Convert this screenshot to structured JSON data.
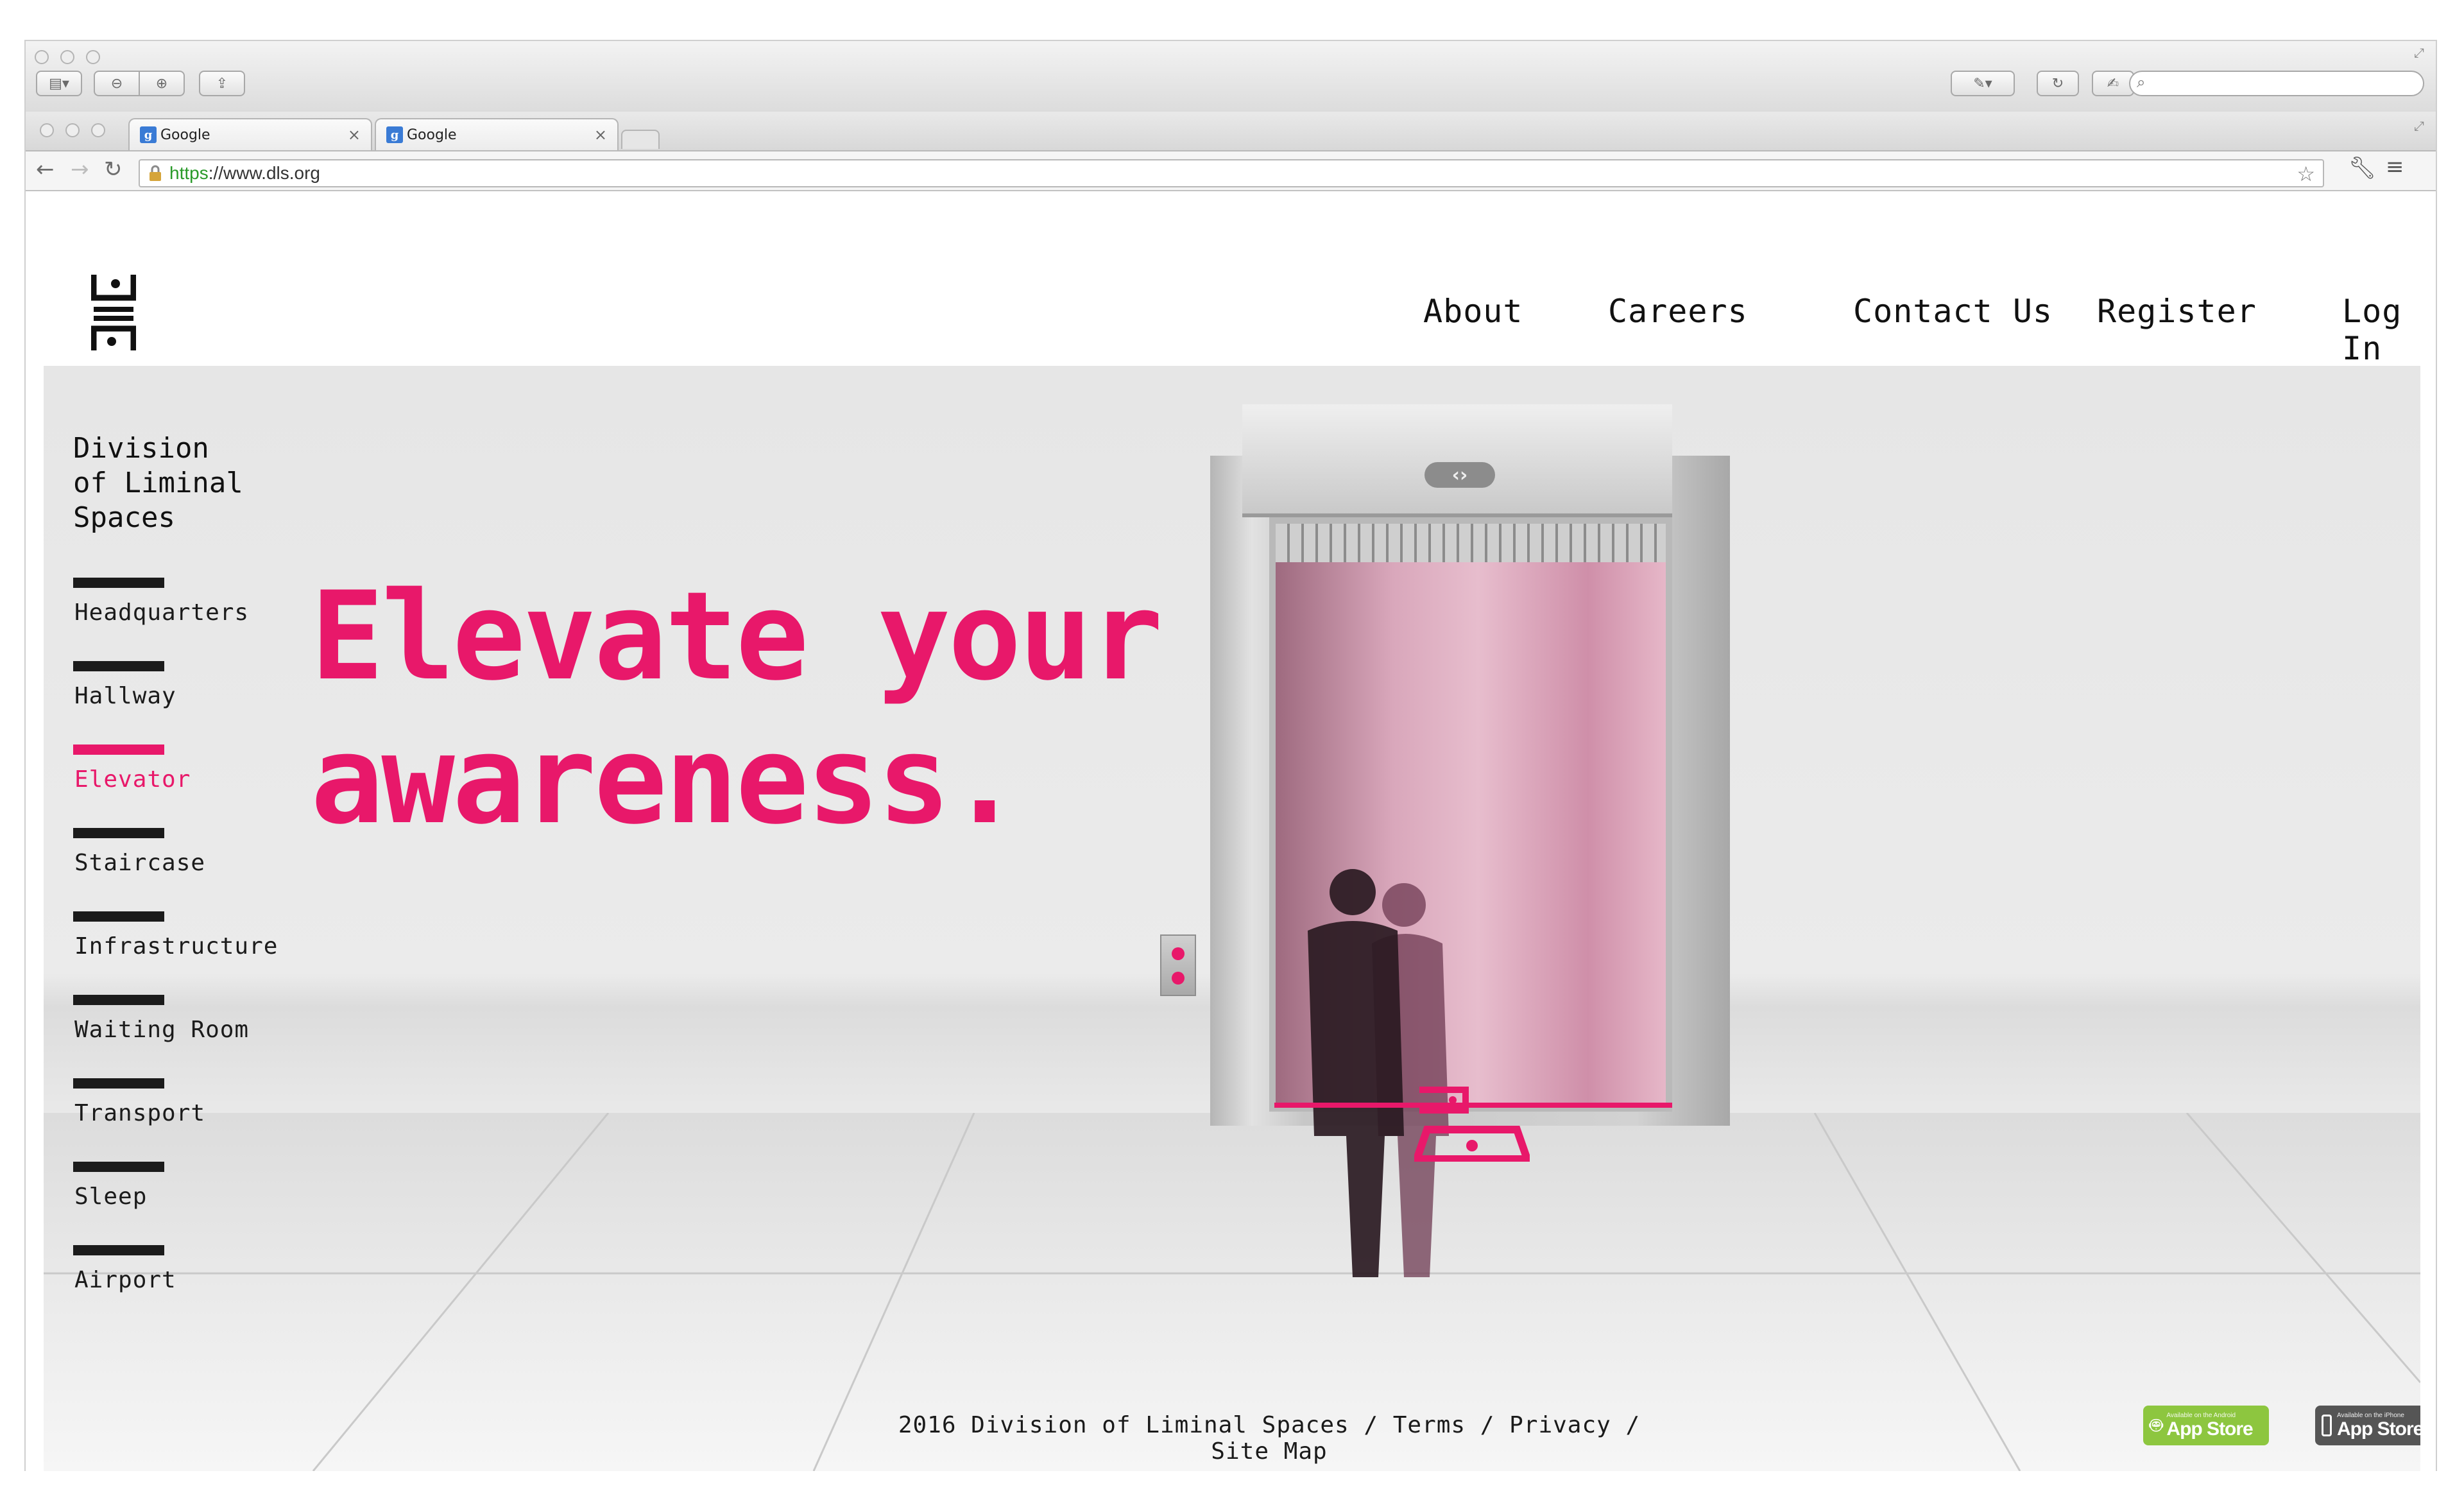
{
  "browser": {
    "tabs": [
      {
        "label": "Google",
        "favicon": "g"
      },
      {
        "label": "Google",
        "favicon": "g"
      }
    ],
    "url": {
      "scheme": "https",
      "rest": "://www.dls.org"
    }
  },
  "site": {
    "nav": [
      "About",
      "Careers",
      "Contact Us",
      "Register",
      "Log In"
    ],
    "brand": "Division\nof Liminal\nSpaces",
    "sidebar": [
      "Headquarters",
      "Hallway",
      "Elevator",
      "Staircase",
      "Infrastructure",
      "Waiting Room",
      "Transport",
      "Sleep",
      "Airport"
    ],
    "active_section": "Elevator",
    "headline": "Elevate your awareness.",
    "footer": "2016 Division of Liminal Spaces / Terms / Privacy / Site Map",
    "badges": [
      {
        "small": "Available on the Android",
        "big": "App Store",
        "icon": "android-icon",
        "color": "#8dc63f"
      },
      {
        "small": "Available on the iPhone",
        "big": "App Store",
        "icon": "iphone-icon",
        "color": "#555555"
      }
    ],
    "accent": "#e8186a"
  }
}
